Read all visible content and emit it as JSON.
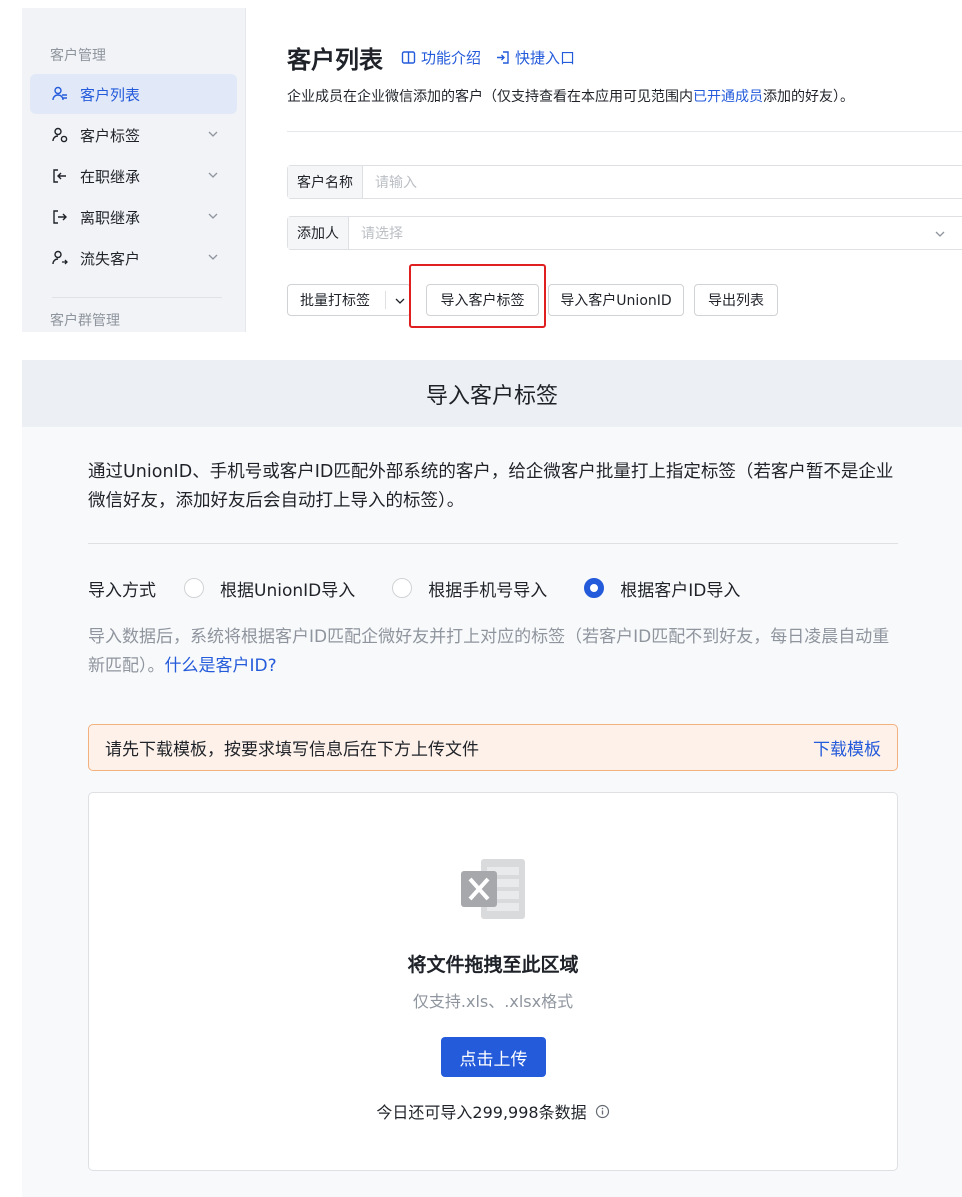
{
  "sidebar": {
    "group1": "客户管理",
    "items": [
      {
        "label": "客户列表",
        "icon": "user-list-icon",
        "active": true
      },
      {
        "label": "客户标签",
        "icon": "user-tag-icon"
      },
      {
        "label": "在职继承",
        "icon": "transfer-in-icon"
      },
      {
        "label": "离职继承",
        "icon": "transfer-out-icon"
      },
      {
        "label": "流失客户",
        "icon": "user-lost-icon"
      }
    ],
    "group2": "客户群管理"
  },
  "page": {
    "title": "客户列表",
    "link_intro": "功能介绍",
    "link_quick": "快捷入口",
    "subtitle_pre": "企业成员在企业微信添加的客户（仅支持查看在本应用可见范围内",
    "subtitle_hl": "已开通成员",
    "subtitle_post": "添加的好友）。"
  },
  "filters": {
    "name_label": "客户名称",
    "name_placeholder": "请输入",
    "adder_label": "添加人",
    "adder_placeholder": "请选择"
  },
  "toolbar": {
    "batch_tag": "批量打标签",
    "import_tags": "导入客户标签",
    "import_unionid": "导入客户UnionID",
    "export": "导出列表"
  },
  "modal": {
    "title": "导入客户标签",
    "description": "通过UnionID、手机号或客户ID匹配外部系统的客户，给企微客户批量打上指定标签（若客户暂不是企业微信好友，添加好友后会自动打上导入的标签）。",
    "import_method_label": "导入方式",
    "options": [
      "根据UnionID导入",
      "根据手机号导入",
      "根据客户ID导入"
    ],
    "selected_option": 2,
    "hint": "导入数据后，系统将根据客户ID匹配企微好友并打上对应的标签（若客户ID匹配不到好友，每日凌晨自动重新匹配）。",
    "hint_link": "什么是客户ID?",
    "notice": "请先下载模板，按要求填写信息后在下方上传文件",
    "download_template": "下载模板",
    "drop_title": "将文件拖拽至此区域",
    "drop_sub": "仅支持.xls、.xlsx格式",
    "upload_button": "点击上传",
    "quota": "今日还可导入299,998条数据"
  },
  "colors": {
    "accent": "#245bdb",
    "highlight": "#e02020",
    "notice_bg": "#fdf1e9",
    "notice_border": "#f3b17e"
  }
}
